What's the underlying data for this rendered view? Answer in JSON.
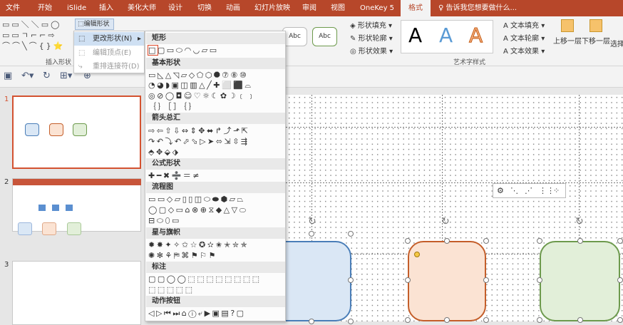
{
  "tabs": [
    {
      "label": "文件"
    },
    {
      "label": "开始"
    },
    {
      "label": "iSlide"
    },
    {
      "label": "插入"
    },
    {
      "label": "美化大师"
    },
    {
      "label": "设计"
    },
    {
      "label": "切换"
    },
    {
      "label": "动画"
    },
    {
      "label": "幻灯片放映"
    },
    {
      "label": "审阅"
    },
    {
      "label": "视图"
    },
    {
      "label": "OneKey 5"
    },
    {
      "label": "格式"
    }
  ],
  "tell_me": "告诉我您想要做什么...",
  "ribbon": {
    "edit_shape": "编辑形状",
    "insert_shapes_label": "插入形状",
    "shape_fill": "形状填充",
    "shape_outline": "形状轮廓",
    "shape_effects": "形状效果",
    "wordart_label": "艺术字样式",
    "wordart_letter": "A",
    "text_fill": "文本填充",
    "text_outline": "文本轮廓",
    "text_effects": "文本效果",
    "bring_forward": "上移一层",
    "send_backward": "下移一层",
    "selection": "选择",
    "style_abc": "Abc"
  },
  "edit_menu": {
    "change_shape": "更改形状(N)",
    "edit_points": "编辑顶点(E)",
    "reroute": "重排连接符(D)"
  },
  "shape_gallery": {
    "categories": [
      {
        "name": "矩形",
        "rows": [
          "□▢▭⬭◠◡▱▭"
        ]
      },
      {
        "name": "基本形状",
        "rows": [
          "▭◺△◹▱◇⬠⬡⯃⑦⑧⑩",
          "◔◕◗▣◫▥△╱✚⬜⬛⌓",
          "◎⊘◯◘☺♡☼☾✿☽﹝﹞",
          "｛｝［］｛｝"
        ]
      },
      {
        "name": "箭头总汇",
        "rows": [
          "⇨⇦⇧⇩⇔⇕✥⬌↱⤴⬏⇱",
          "↷↶⤵↶⬀⬂▷➤⬄⇲⇳⇶",
          "⬘✥⬙⬗"
        ]
      },
      {
        "name": "公式形状",
        "rows": [
          "✚━✖➗＝≠"
        ]
      },
      {
        "name": "流程图",
        "rows": [
          "▭▭◇▱▯▯◫⬭⬬⬢▱⏢",
          "◯▢◇▭⌂⊗⊕⧖◆△▽⬭",
          "⊟⬭⬯▭"
        ]
      },
      {
        "name": "星与旗帜",
        "rows": [
          "✹✸✦✧✩☆✪✫✬✭✮✯",
          "✺✻⚘⛿⌘⚑⚐⚑"
        ]
      },
      {
        "name": "标注",
        "rows": [
          "▢▢◯◯⬚⬚⬚⬚⬚⬚⬚⬚",
          "⬚⬚⬚⬚⬚"
        ]
      },
      {
        "name": "动作按钮",
        "rows": [
          "◁▷⏮⏭⌂ⓘ⤶▶▣▤?▢"
        ]
      }
    ]
  },
  "slides": [
    {
      "number": "1"
    },
    {
      "number": "2"
    },
    {
      "number": "3"
    }
  ],
  "colors": {
    "accent": "#b7472a",
    "shape1_fill": "#dae7f5",
    "shape1_border": "#4a7eb8",
    "shape2_fill": "#fbe3d3",
    "shape2_border": "#c45e2a",
    "shape3_fill": "#e2efd9",
    "shape3_border": "#6d9a4d"
  }
}
